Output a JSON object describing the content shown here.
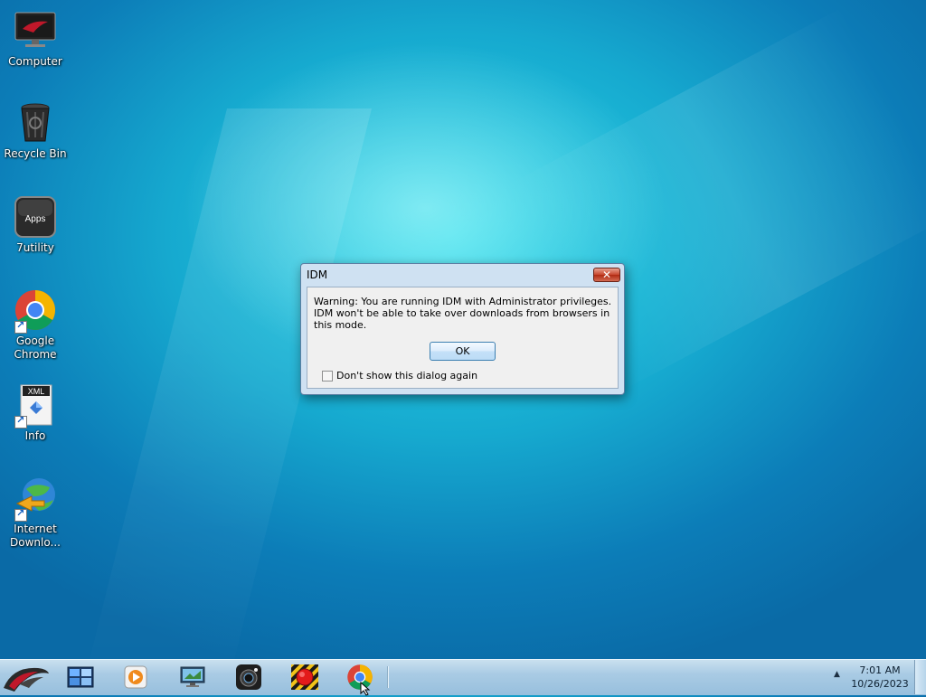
{
  "desktop": {
    "icons": [
      {
        "label": "Computer",
        "icon": "computer-icon",
        "shortcut": false
      },
      {
        "label": "Recycle Bin",
        "icon": "recycle-bin-icon",
        "shortcut": false
      },
      {
        "label": "7utility",
        "icon": "apps-icon",
        "badge": "Apps",
        "shortcut": false
      },
      {
        "label": "Google Chrome",
        "icon": "chrome-icon",
        "shortcut": true
      },
      {
        "label": "Info",
        "icon": "xml-file-icon",
        "badge": "XML",
        "shortcut": true
      },
      {
        "label": "Internet Downlo...",
        "icon": "idm-icon",
        "shortcut": true
      }
    ]
  },
  "dialog": {
    "title": "IDM",
    "message_line1": "Warning: You are running IDM with Administrator privileges.",
    "message_line2": "IDM won't be able to take over downloads from browsers in this mode.",
    "ok_label": "OK",
    "checkbox_label": "Don't show this dialog again",
    "checkbox_checked": false,
    "close_glyph": "✕"
  },
  "taskbar": {
    "start_icon": "rog-logo-icon",
    "pinned": [
      {
        "name": "explorer-icon"
      },
      {
        "name": "media-player-icon"
      },
      {
        "name": "remote-desktop-icon"
      },
      {
        "name": "camera-icon"
      },
      {
        "name": "record-icon"
      },
      {
        "name": "chrome-icon"
      }
    ],
    "tray_arrow": "▲",
    "clock_time": "7:01 AM",
    "clock_date": "10/26/2023"
  },
  "colors": {
    "desktop_bg": "#16a9cf",
    "dialog_frame": "#cfe1f2",
    "close_red": "#c7452c",
    "taskbar": "#a9cbe4"
  }
}
